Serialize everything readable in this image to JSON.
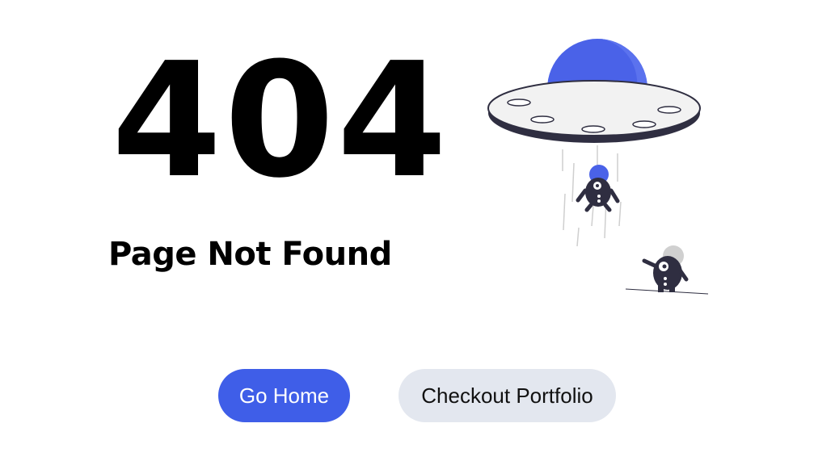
{
  "error": {
    "code": "404",
    "title": "Page Not Found"
  },
  "actions": {
    "home_label": "Go Home",
    "portfolio_label": "Checkout Portfolio"
  },
  "illustration": {
    "icon": "ufo-abduction-illustration",
    "colors": {
      "accent": "#4a62e8",
      "dark": "#2f2e41",
      "light": "#e6e6e6"
    }
  },
  "colors": {
    "primary_button": "#3f5ee8",
    "secondary_button": "#e3e7ef",
    "text": "#000000"
  }
}
